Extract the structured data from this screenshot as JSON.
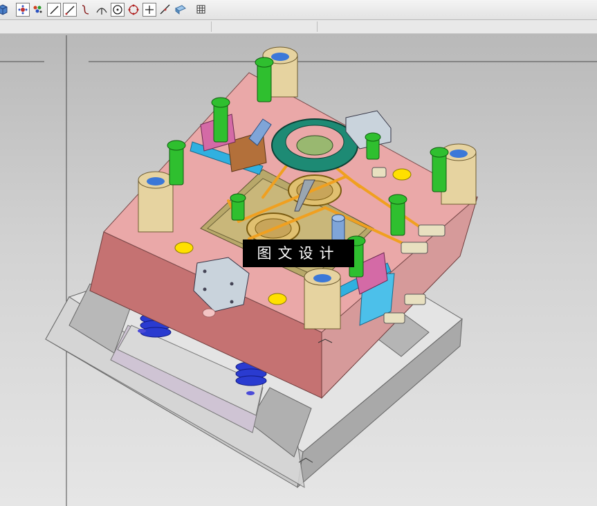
{
  "toolbar": {
    "buttons": [
      {
        "name": "view-cube-icon"
      },
      {
        "name": "snap-point-icon"
      },
      {
        "name": "snap-grid-icon"
      },
      {
        "name": "line-icon"
      },
      {
        "name": "line-two-point-icon"
      },
      {
        "name": "curve-icon"
      },
      {
        "name": "tangent-icon"
      },
      {
        "name": "circle-center-icon"
      },
      {
        "name": "circle-points-icon"
      },
      {
        "name": "cross-point-icon"
      },
      {
        "name": "diagonal-line-icon"
      },
      {
        "name": "measure-icon"
      },
      {
        "name": "grid-icon"
      }
    ]
  },
  "watermark": {
    "text": "图文设计"
  },
  "colors": {
    "plate_pink": "#e8a3a3",
    "plate_side": "#c57272",
    "base_gray": "#bdbdbd",
    "bolt_green": "#2fbf2f",
    "bushing_tan": "#e6d3a0",
    "ring_teal": "#1d8a74",
    "rod_orange": "#f0a020",
    "spring_blue": "#2a3bd0",
    "locator_yellow": "#ffe000"
  }
}
